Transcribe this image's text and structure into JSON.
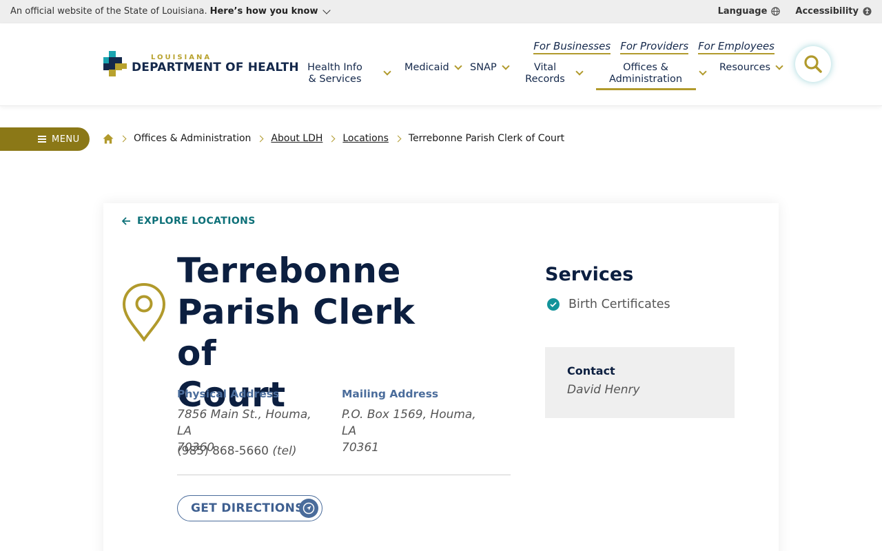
{
  "gov_bar": {
    "official_text": "An official website of the State of Louisiana.",
    "how_you_know": "Here’s how you know",
    "language": "Language",
    "accessibility": "Accessibility"
  },
  "logo": {
    "small": "LOUISIANA",
    "big": "DEPARTMENT OF HEALTH"
  },
  "util_links": [
    "For Businesses",
    "For Providers",
    "For Employees"
  ],
  "nav": {
    "health_info": [
      "Health Info",
      "& Services"
    ],
    "medicaid": "Medicaid",
    "snap": "SNAP",
    "vital": [
      "Vital",
      "Records"
    ],
    "offices": [
      "Offices &",
      "Administration"
    ],
    "resources": "Resources"
  },
  "menu_label": "MENU",
  "breadcrumb": [
    "Offices & Administration",
    "About LDH",
    "Locations",
    "Terrebonne Parish Clerk of Court"
  ],
  "card": {
    "explore": "EXPLORE LOCATIONS",
    "title_lines": [
      "Terrebonne",
      "Parish Clerk of",
      "Court"
    ],
    "physical_head": "Physical Address",
    "physical_lines": [
      "7856 Main St., Houma, LA",
      "70360"
    ],
    "mailing_head": "Mailing Address",
    "mailing_lines": [
      "P.O. Box 1569, Houma, LA",
      "70361"
    ],
    "phone": "(985) 868-5660",
    "phone_suffix": "(tel)",
    "directions": "GET DIRECTIONS",
    "services_head": "Services",
    "service_1": "Birth Certificates",
    "contact_head": "Contact",
    "contact_name": "David Henry"
  },
  "colors": {
    "gold": "#b19a2c",
    "navy": "#14284b",
    "teal": "#12939a",
    "slate_blue": "#4a6c9b"
  }
}
